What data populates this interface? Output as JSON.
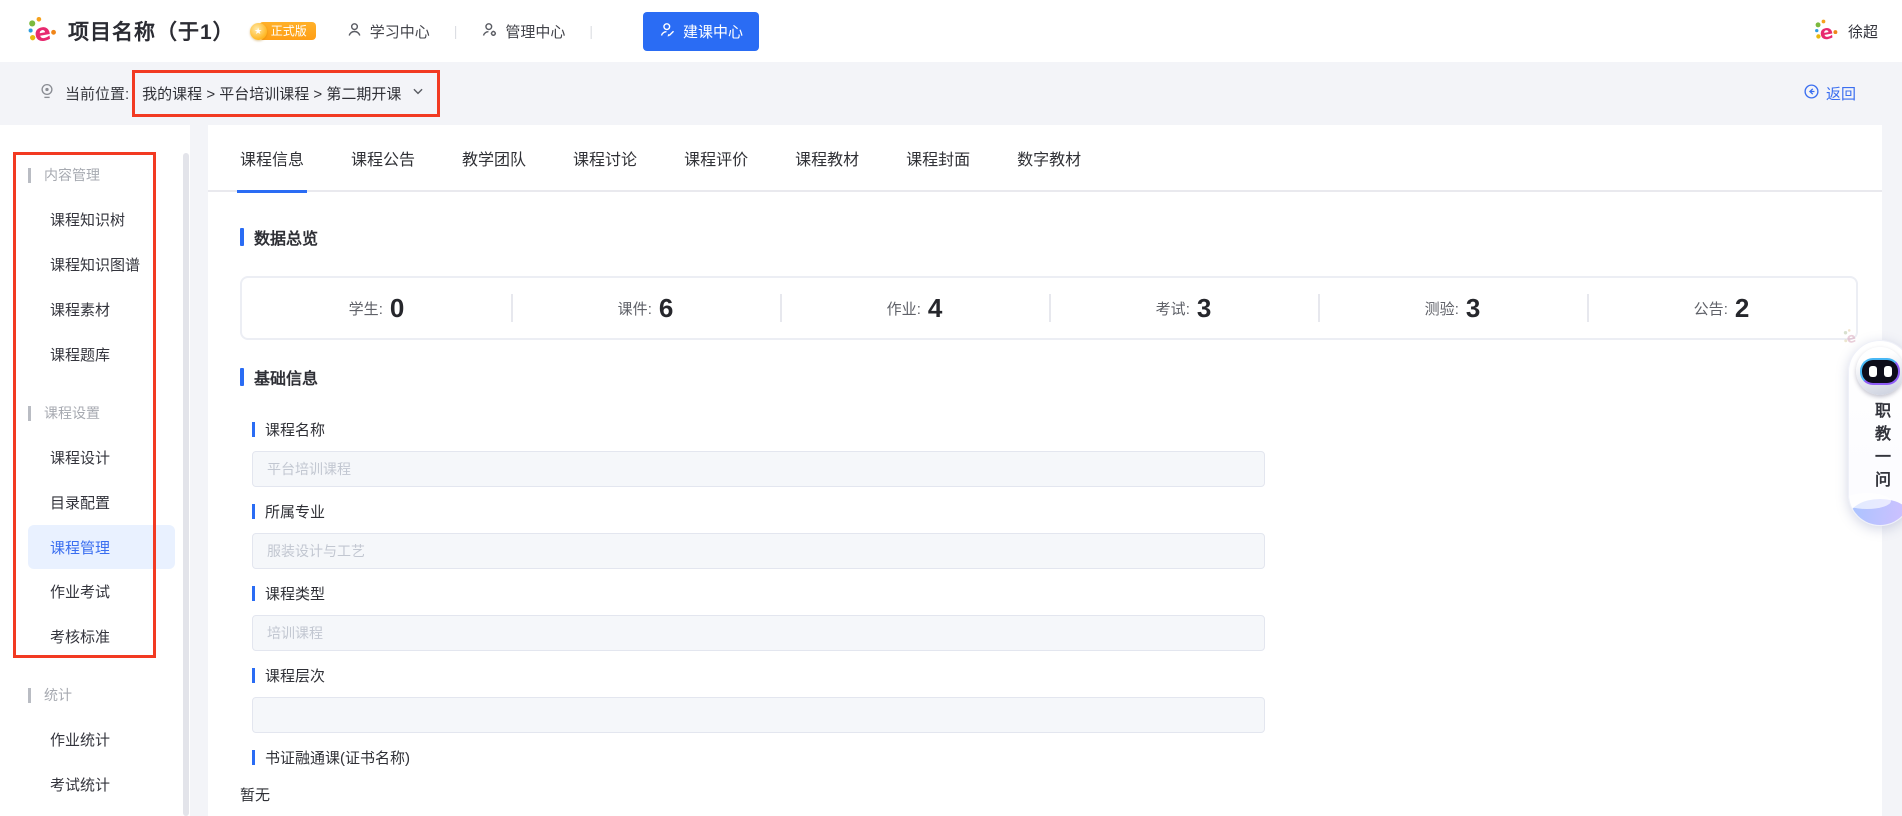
{
  "colors": {
    "accent": "#2a6cf4",
    "annotation_red": "#f23a22",
    "badge_orange": "#ffa41f",
    "active_item_bg": "#e9f1ff"
  },
  "header": {
    "title": "项目名称（于1）",
    "badge": "正式版",
    "nav": [
      {
        "label": "学习中心"
      },
      {
        "label": "管理中心"
      },
      {
        "label": "建课中心",
        "active": true
      }
    ],
    "user_name": "徐超"
  },
  "breadcrumb": {
    "prefix": "当前位置:",
    "path": "我的课程 > 平台培训课程 > 第二期开课",
    "back_label": "返回"
  },
  "sidebar": {
    "sections": [
      {
        "title": "内容管理",
        "items": [
          {
            "label": "课程知识树"
          },
          {
            "label": "课程知识图谱"
          },
          {
            "label": "课程素材"
          },
          {
            "label": "课程题库"
          }
        ]
      },
      {
        "title": "课程设置",
        "items": [
          {
            "label": "课程设计"
          },
          {
            "label": "目录配置"
          },
          {
            "label": "课程管理",
            "active": true
          },
          {
            "label": "作业考试"
          },
          {
            "label": "考核标准"
          }
        ]
      },
      {
        "title": "统计",
        "items": [
          {
            "label": "作业统计"
          },
          {
            "label": "考试统计"
          }
        ]
      }
    ]
  },
  "main": {
    "tabs": [
      {
        "label": "课程信息",
        "active": true
      },
      {
        "label": "课程公告"
      },
      {
        "label": "教学团队"
      },
      {
        "label": "课程讨论"
      },
      {
        "label": "课程评价"
      },
      {
        "label": "课程教材"
      },
      {
        "label": "课程封面"
      },
      {
        "label": "数字教材"
      }
    ],
    "overview": {
      "title": "数据总览",
      "stats": [
        {
          "label": "学生",
          "value": "0"
        },
        {
          "label": "课件",
          "value": "6"
        },
        {
          "label": "作业",
          "value": "4"
        },
        {
          "label": "考试",
          "value": "3"
        },
        {
          "label": "测验",
          "value": "3"
        },
        {
          "label": "公告",
          "value": "2"
        }
      ]
    },
    "basic_info": {
      "title": "基础信息",
      "fields": [
        {
          "label": "课程名称",
          "value": "平台培训课程"
        },
        {
          "label": "所属专业",
          "value": "服装设计与工艺"
        },
        {
          "label": "课程类型",
          "value": "培训课程"
        },
        {
          "label": "课程层次",
          "value": ""
        }
      ],
      "cert_label": "书证融通课(证书名称)",
      "cert_value": "暂无"
    }
  },
  "assistant": {
    "label": "职教一问"
  }
}
